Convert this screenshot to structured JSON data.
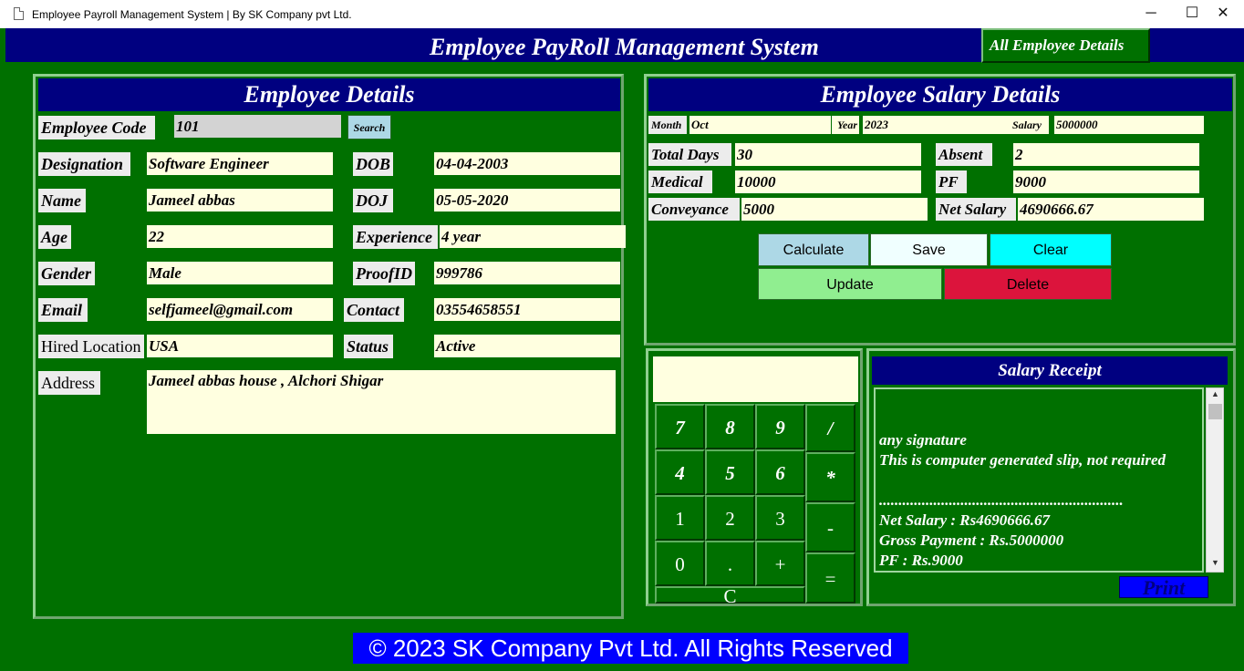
{
  "window": {
    "title": "Employee Payroll Management System | By SK Company pvt Ltd.",
    "minimize": "─",
    "maximize": "☐",
    "close": "✕"
  },
  "header": {
    "title": "Employee PayRoll Management System",
    "all_employee_button": "All Employee Details"
  },
  "employee_details": {
    "title": "Employee Details",
    "employee_code_label": "Employee Code",
    "employee_code_value": "101",
    "search_button": "Search",
    "designation_label": "Designation",
    "designation_value": "Software Engineer",
    "dob_label": "DOB",
    "dob_value": "04-04-2003",
    "name_label": "Name",
    "name_value": "Jameel abbas",
    "doj_label": "DOJ",
    "doj_value": "05-05-2020",
    "age_label": "Age",
    "age_value": "22",
    "experience_label": "Experience",
    "experience_value": "4 year",
    "gender_label": "Gender",
    "gender_value": "Male",
    "proofid_label": "ProofID",
    "proofid_value": "999786",
    "email_label": "Email",
    "email_value": "selfjameel@gmail.com",
    "contact_label": "Contact",
    "contact_value": "03554658551",
    "hired_location_label": "Hired Location",
    "hired_location_value": "USA",
    "status_label": "Status",
    "status_value": "Active",
    "address_label": "Address",
    "address_value": "Jameel abbas house , Alchori Shigar"
  },
  "salary_details": {
    "title": "Employee Salary Details",
    "month_label": "Month",
    "month_value": "Oct",
    "year_label": "Year",
    "year_value": "2023",
    "salary_label": "Salary",
    "salary_value": "5000000",
    "total_days_label": "Total Days",
    "total_days_value": "30",
    "absent_label": "Absent",
    "absent_value": "2",
    "medical_label": "Medical",
    "medical_value": "10000",
    "pf_label": "PF",
    "pf_value": "9000",
    "conveyance_label": "Conveyance",
    "conveyance_value": "5000",
    "net_salary_label": "Net Salary",
    "net_salary_value": "4690666.67",
    "buttons": {
      "calculate": "Calculate",
      "save": "Save",
      "clear": "Clear",
      "update": "Update",
      "delete": "Delete"
    },
    "colors": {
      "calculate": "#add8e6",
      "save": "#f0ffff",
      "clear": "#00ffff",
      "update": "#90ee90",
      "delete": "#dc143c"
    }
  },
  "calculator": {
    "display": "",
    "keys": {
      "k7": "7",
      "k8": "8",
      "k9": "9",
      "div": "/",
      "k4": "4",
      "k5": "5",
      "k6": "6",
      "mul": "*",
      "k1": "1",
      "k2": "2",
      "k3": "3",
      "sub": "-",
      "k0": "0",
      "dot": ".",
      "add": "+",
      "eq": "=",
      "clear": "C"
    }
  },
  "receipt": {
    "title": "Salary Receipt",
    "lines": [
      "any signature",
      "This is computer generated slip, not required",
      "...............................................................",
      "Net Salary          :  Rs4690666.67",
      "Gross Payment    :  Rs.5000000",
      "PF                     :  Rs.9000"
    ],
    "print_button": "Print"
  },
  "footer": {
    "text": "© 2023 SK Company Pvt Ltd. All Rights Reserved"
  }
}
